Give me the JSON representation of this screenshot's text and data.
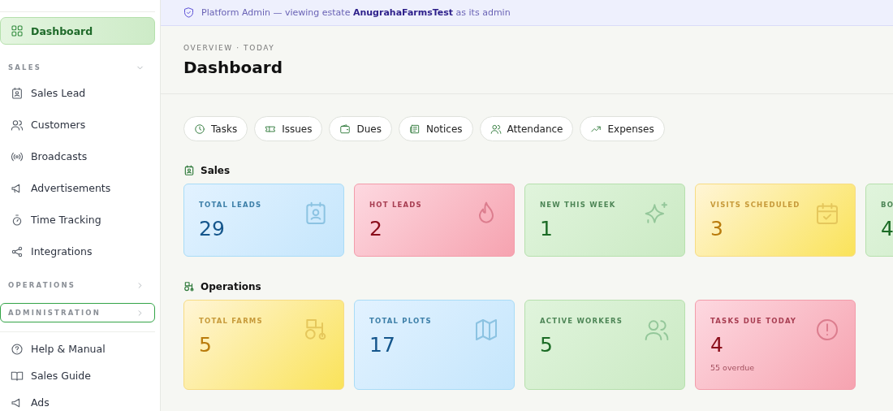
{
  "sidebar": {
    "items": [
      {
        "label": "Dashboard",
        "selected": true
      }
    ],
    "sections": [
      {
        "title": "SALES",
        "expanded": true,
        "focused": false,
        "children": [
          {
            "label": "Sales Lead",
            "selected": false
          },
          {
            "label": "Customers",
            "selected": false
          },
          {
            "label": "Broadcasts",
            "selected": false
          },
          {
            "label": "Advertisements",
            "selected": false
          },
          {
            "label": "Time Tracking",
            "selected": false
          },
          {
            "label": "Integrations",
            "selected": false
          }
        ]
      },
      {
        "title": "OPERATIONS",
        "expanded": false,
        "focused": false
      },
      {
        "title": "ADMINISTRATION",
        "expanded": false,
        "focused": true
      }
    ],
    "footer_items": [
      {
        "label": "Help & Manual"
      },
      {
        "label": "Sales Guide"
      },
      {
        "label": "Ads"
      }
    ]
  },
  "banner": {
    "text": "Platform Admin — viewing estate **AnugrahaFarmsTest** as its admin"
  },
  "header": {
    "eyebrow": "OVERVIEW · TODAY",
    "title": "Dashboard"
  },
  "quick_actions": [
    "Tasks",
    "Issues",
    "Dues",
    "Notices",
    "Attendance",
    "Expenses"
  ],
  "groups": [
    {
      "title": "Sales",
      "cards": [
        {
          "label": "TOTAL LEADS",
          "value": "29",
          "kind": "blue"
        },
        {
          "label": "HOT LEADS",
          "value": "2",
          "kind": "red"
        },
        {
          "label": "NEW THIS WEEK",
          "value": "1",
          "kind": "green"
        },
        {
          "label": "VISITS SCHEDULED",
          "value": "3",
          "kind": "yellow"
        },
        {
          "label": "BO",
          "value": "4",
          "kind": "green"
        }
      ]
    },
    {
      "title": "Operations",
      "cards": [
        {
          "label": "TOTAL FARMS",
          "value": "5",
          "kind": "yellow"
        },
        {
          "label": "TOTAL PLOTS",
          "value": "17",
          "kind": "blue"
        },
        {
          "label": "ACTIVE WORKERS",
          "value": "5",
          "kind": "green"
        },
        {
          "label": "TASKS DUE TODAY",
          "value": "4",
          "kind": "red",
          "note": "55 overdue"
        }
      ]
    }
  ]
}
